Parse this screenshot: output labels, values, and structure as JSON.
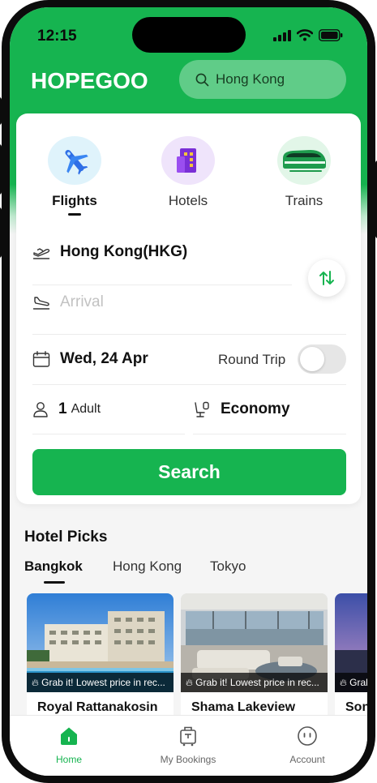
{
  "status": {
    "time": "12:15"
  },
  "header": {
    "logo_text": "HOPEGOO",
    "search_value": "Hong Kong"
  },
  "categories": [
    {
      "label": "Flights",
      "active": true
    },
    {
      "label": "Hotels",
      "active": false
    },
    {
      "label": "Trains",
      "active": false
    }
  ],
  "form": {
    "departure": "Hong Kong(HKG)",
    "arrival_placeholder": "Arrival",
    "date": "Wed, 24 Apr",
    "round_trip_label": "Round Trip",
    "round_trip_enabled": false,
    "passengers_count": "1",
    "passengers_unit": "Adult",
    "cabin_class": "Economy",
    "search_label": "Search"
  },
  "hotel_picks": {
    "title": "Hotel Picks",
    "tabs": [
      {
        "label": "Bangkok",
        "active": true
      },
      {
        "label": "Hong Kong",
        "active": false
      },
      {
        "label": "Tokyo",
        "active": false
      }
    ],
    "cards": [
      {
        "name": "Royal Rattanakosin",
        "tag": "Grab it! Lowest price in rec..."
      },
      {
        "name": "Shama Lakeview",
        "tag": "Grab it! Lowest price in rec..."
      },
      {
        "name": "Son",
        "tag": "Grab"
      }
    ]
  },
  "bottom_nav": [
    {
      "label": "Home",
      "active": true,
      "icon": "home-icon"
    },
    {
      "label": "My Bookings",
      "active": false,
      "icon": "luggage-icon"
    },
    {
      "label": "Account",
      "active": false,
      "icon": "account-icon"
    }
  ],
  "colors": {
    "brand_green": "#16b450",
    "text_dark": "#111111"
  }
}
